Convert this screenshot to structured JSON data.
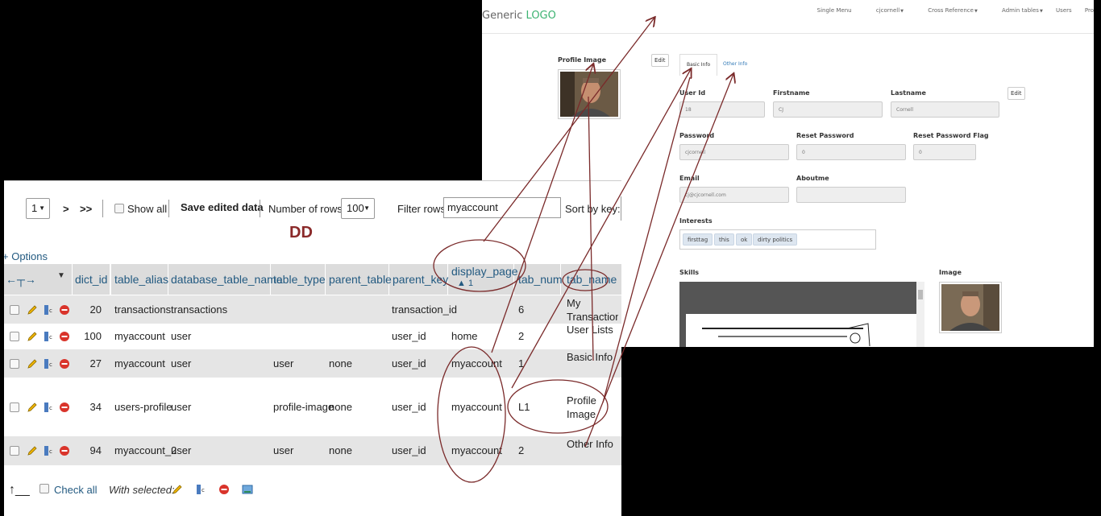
{
  "app": {
    "logo_prefix": "Generic ",
    "logo_accent": "LOGO",
    "nav": [
      "Single Menu",
      "cjcornell",
      "Cross Reference",
      "Admin tables",
      "Users",
      "Pro"
    ],
    "profile_image_label": "Profile Image",
    "edit_label": "Edit",
    "tabs": [
      "Basic Info",
      "Other Info"
    ],
    "fields": {
      "user_id": {
        "label": "User Id",
        "value": "18"
      },
      "firstname": {
        "label": "Firstname",
        "value": "CJ"
      },
      "lastname": {
        "label": "Lastname",
        "value": "Cornell"
      },
      "password": {
        "label": "Password",
        "value": "cjcornell"
      },
      "reset_password": {
        "label": "Reset Password",
        "value": "0"
      },
      "reset_password_flag": {
        "label": "Reset Password Flag",
        "value": "0"
      },
      "email": {
        "label": "Email",
        "value": "cj@cjcornell.com"
      },
      "aboutme": {
        "label": "Aboutme",
        "value": ""
      }
    },
    "interests_label": "Interests",
    "interests": [
      "firsttag",
      "this",
      "ok",
      "dirty politics"
    ],
    "skills_label": "Skills",
    "image_label": "Image"
  },
  "pma": {
    "page_select": "1",
    "nav_next": ">",
    "nav_last": ">>",
    "show_all": "Show all",
    "save_edited": "Save edited data",
    "rows_label": "Number of rows:",
    "rows_value": "100",
    "filter_label": "Filter rows:",
    "filter_value": "myaccount",
    "sort_label": "Sort by key:",
    "annotation": "DD",
    "options": "+ Options",
    "columns": [
      "dict_id",
      "table_alias",
      "database_table_name",
      "table_type",
      "parent_table",
      "parent_key",
      "display_page",
      "tab_num",
      "tab_name"
    ],
    "sort_indicator": "1",
    "rows": [
      {
        "dict_id": "20",
        "table_alias": "transactions",
        "database_table_name": "transactions",
        "table_type": "",
        "parent_table": "",
        "parent_key": "transaction_id",
        "display_page": "",
        "tab_num": "6",
        "tab_name": "My Transaction"
      },
      {
        "dict_id": "100",
        "table_alias": "myaccount",
        "database_table_name": "user",
        "table_type": "",
        "parent_table": "",
        "parent_key": "user_id",
        "display_page": "home",
        "tab_num": "2",
        "tab_name": "User Lists"
      },
      {
        "dict_id": "27",
        "table_alias": "myaccount",
        "database_table_name": "user",
        "table_type": "user",
        "parent_table": "none",
        "parent_key": "user_id",
        "display_page": "myaccount",
        "tab_num": "1",
        "tab_name": "Basic Info"
      },
      {
        "dict_id": "34",
        "table_alias": "users-profile",
        "database_table_name": "user",
        "table_type": "profile-image",
        "parent_table": "none",
        "parent_key": "user_id",
        "display_page": "myaccount",
        "tab_num": "L1",
        "tab_name": "Profile Image"
      },
      {
        "dict_id": "94",
        "table_alias": "myaccount_2",
        "database_table_name": "user",
        "table_type": "user",
        "parent_table": "none",
        "parent_key": "user_id",
        "display_page": "myaccount",
        "tab_num": "2",
        "tab_name": "Other Info"
      }
    ],
    "check_all": "Check all",
    "with_selected": "With selected:"
  },
  "colors": {
    "link": "#235a81",
    "annotation": "#8b2a2a",
    "logo_accent": "#3cb371"
  }
}
